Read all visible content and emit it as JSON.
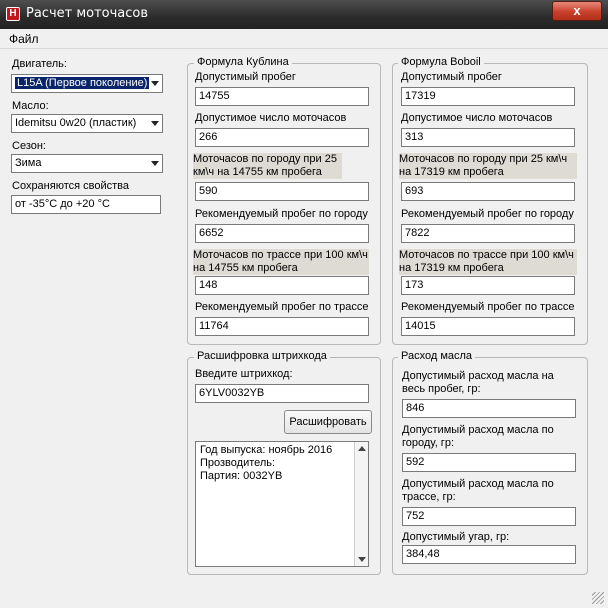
{
  "window": {
    "title": "Расчет моточасов",
    "app_icon": "H",
    "close_glyph": "x"
  },
  "menu": {
    "file": "Файл"
  },
  "left": {
    "engine_label": "Двигатель:",
    "engine_value": "L15A (Первое поколение)",
    "oil_label": "Масло:",
    "oil_value": "Idemitsu 0w20 (пластик)",
    "season_label": "Сезон:",
    "season_value": "Зима",
    "props_label": "Сохраняются свойства",
    "props_value": "от -35°C до +20 °C"
  },
  "kublin": {
    "title": "Формула Кублина",
    "f1_label": "Допустимый пробег",
    "f1_value": "14755",
    "f2_label": "Допустимое число моточасов",
    "f2_value": "266",
    "f3_label": "Моточасов по городу при 25 км\\ч на 14755 км пробега",
    "f3_value": "590",
    "f4_label": "Рекомендуемый пробег по городу",
    "f4_value": "6652",
    "f5_label": "Моточасов по трассе при 100 км\\ч на 14755 км пробега",
    "f5_value": "148",
    "f6_label": "Рекомендуемый  пробег по трассе",
    "f6_value": "11764"
  },
  "boboil": {
    "title": "Формула Boboil",
    "f1_label": "Допустимый пробег",
    "f1_value": "17319",
    "f2_label": "Допустимое число моточасов",
    "f2_value": "313",
    "f3_label": "Моточасов по городу при 25 км\\ч на 17319 км пробега",
    "f3_value": "693",
    "f4_label": "Рекомендуемый пробег по городу",
    "f4_value": "7822",
    "f5_label": "Моточасов по трассе при 100 км\\ч на 17319 км пробега",
    "f5_value": "173",
    "f6_label": "Рекомендуемый пробег по трассе",
    "f6_value": "14015"
  },
  "barcode": {
    "title": "Расшифровка штрихкода",
    "input_label": "Введите штрихкод:",
    "input_value": "6YLV0032YB",
    "decode_button": "Расшифровать",
    "result_line1": "Год выпуска: ноябрь 2016",
    "result_line2": "Прозводитель:",
    "result_line3": "Партия: 0032YB"
  },
  "oil": {
    "title": "Расход масла",
    "f1_label": "Допустимый расход масла на весь пробег, гр:",
    "f1_value": "846",
    "f2_label": "Допустимый расход масла по городу, гр:",
    "f2_value": "592",
    "f3_label": "Допустимый расход масла по трассе, гр:",
    "f3_value": "752",
    "f4_label": "Допустимый угар, гр:",
    "f4_value": "384,48"
  }
}
